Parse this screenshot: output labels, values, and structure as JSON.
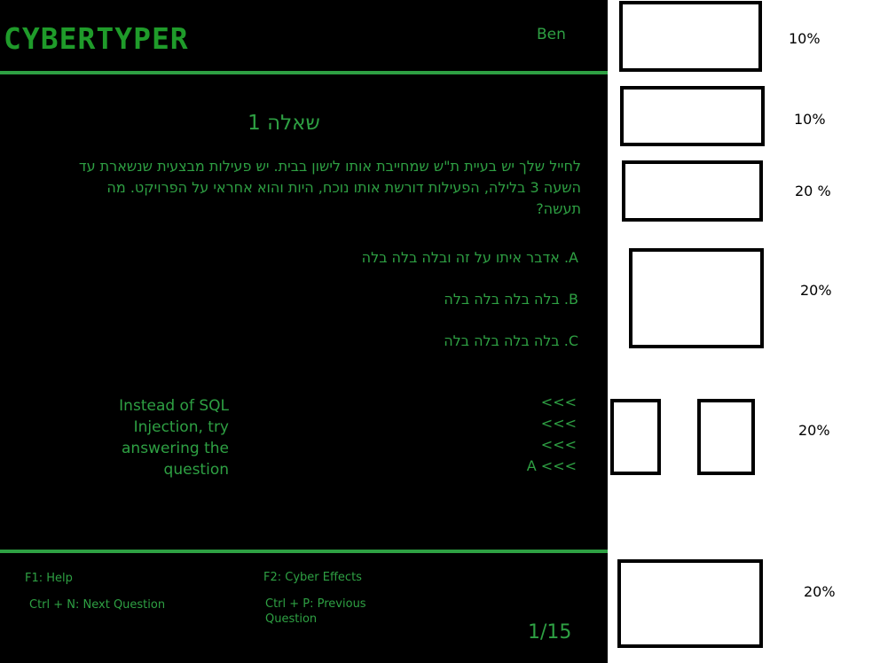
{
  "header": {
    "logo": "CYBERTYPER",
    "user": "Ben"
  },
  "question": {
    "title": "שאלה 1",
    "text": "לחייל שלך יש בעיית ת\"ש שמחייבת אותו לישון בבית. יש פעילות מבצעית שנשארת עד השעה 3 בלילה, הפעילות דורשת אותו נוכח, היות והוא אחראי על הפרויקט. מה תעשה?",
    "answers": [
      "A. אדבר איתו על זה ובלה בלה בלה",
      "B. בלה בלה בלה בלה",
      "C. בלה בלה בלה בלה"
    ]
  },
  "hint": {
    "lines": [
      "Instead of SQL",
      "Injection, try",
      "answering the",
      "question"
    ]
  },
  "input_lines": [
    "<<<",
    "<<<",
    "<<<",
    "A <<<"
  ],
  "shortcuts": {
    "help": "F1: Help",
    "effects": "F2: Cyber Effects",
    "next": "Ctrl + N: Next Question",
    "previous_line1": "Ctrl + P: Previous",
    "previous_line2": "Question"
  },
  "counter": "1/15",
  "layout_annotations": [
    "10%",
    "10%",
    "20 %",
    "20%",
    "20%",
    "20%"
  ],
  "colors": {
    "background": "#000000",
    "accent": "#2ea043"
  }
}
